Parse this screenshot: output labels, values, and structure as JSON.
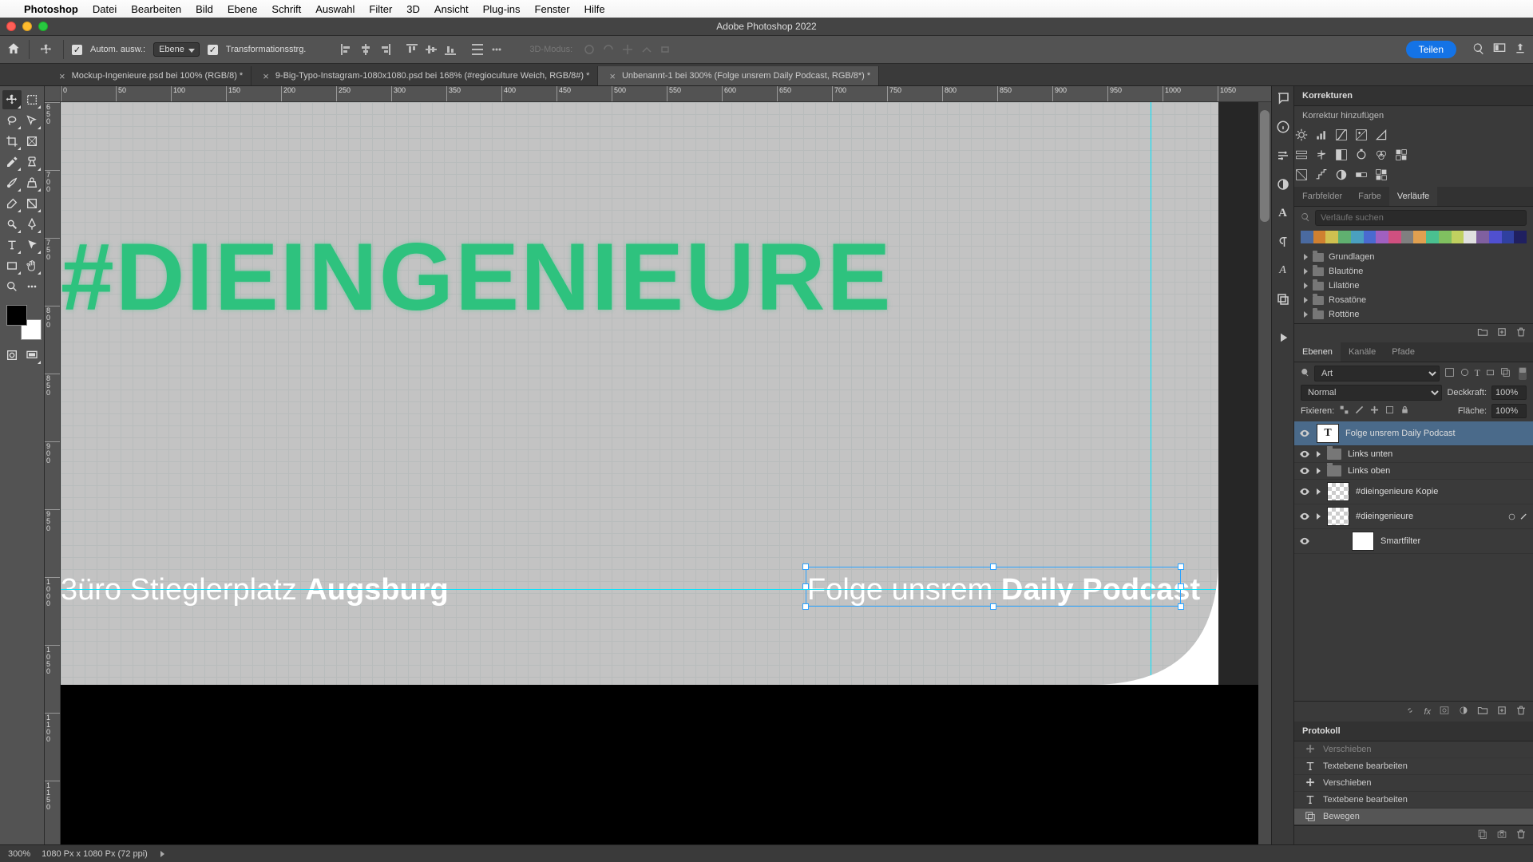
{
  "menubar": {
    "app": "Photoshop",
    "items": [
      "Datei",
      "Bearbeiten",
      "Bild",
      "Ebene",
      "Schrift",
      "Auswahl",
      "Filter",
      "3D",
      "Ansicht",
      "Plug-ins",
      "Fenster",
      "Hilfe"
    ]
  },
  "window": {
    "title": "Adobe Photoshop 2022"
  },
  "options": {
    "auto_select_label": "Autom. ausw.:",
    "auto_select_value": "Ebene",
    "transform_label": "Transformationsstrg.",
    "mode3d_label": "3D-Modus:",
    "share_label": "Teilen"
  },
  "tabs": [
    {
      "label": "Mockup-Ingenieure.psd bei 100% (RGB/8) *",
      "active": false
    },
    {
      "label": "9-Big-Typo-Instagram-1080x1080.psd bei 168% (#regioculture Weich, RGB/8#) *",
      "active": false
    },
    {
      "label": "Unbenannt-1 bei 300% (Folge unsrem Daily Podcast, RGB/8*) *",
      "active": true
    }
  ],
  "ruler_h": [
    "0",
    "50",
    "100",
    "150",
    "200",
    "250",
    "300",
    "350",
    "400",
    "450",
    "500",
    "550",
    "600",
    "650",
    "700",
    "750",
    "800",
    "850",
    "900",
    "950",
    "1000",
    "1050"
  ],
  "ruler_v": [
    "650",
    "700",
    "750",
    "800",
    "850",
    "900",
    "950",
    "1000",
    "1050",
    "1100",
    "1150"
  ],
  "canvas": {
    "big_text": "#DIEINGENIEURE",
    "left_text_prefix": "3üro Stieglerplatz ",
    "left_text_bold": "Augsburg",
    "right_text_prefix": "Folge unsrem ",
    "right_text_bold": "Daily Podcast"
  },
  "panels": {
    "corrections": {
      "title": "Korrekturen",
      "hint": "Korrektur hinzufügen"
    },
    "swatch_tabs": [
      "Farbfelder",
      "Farbe",
      "Verläufe"
    ],
    "search_placeholder": "Verläufe suchen",
    "gradient_colors": [
      "#4a6aa0",
      "#d08030",
      "#d0c050",
      "#60b070",
      "#4aa0c0",
      "#4a6ad0",
      "#a060c0",
      "#d05080",
      "#808080",
      "#e0a050",
      "#4ac090",
      "#80c060",
      "#c0d060",
      "#e0e0e0",
      "#8060a0",
      "#5050d0",
      "#3040a0",
      "#202060"
    ],
    "folders": [
      "Grundlagen",
      "Blautöne",
      "Lilatöne",
      "Rosatöne",
      "Rottöne"
    ]
  },
  "layers_panel": {
    "tabs": [
      "Ebenen",
      "Kanäle",
      "Pfade"
    ],
    "kind_label": "Art",
    "blend_mode": "Normal",
    "opacity_label": "Deckkraft:",
    "opacity_value": "100%",
    "lock_label": "Fixieren:",
    "fill_label": "Fläche:",
    "fill_value": "100%",
    "layers": [
      {
        "name": "Folge unsrem Daily Podcast",
        "type": "text",
        "selected": true,
        "eye": true
      },
      {
        "name": "Links unten",
        "type": "folder",
        "eye": true
      },
      {
        "name": "Links oben",
        "type": "folder",
        "eye": true
      },
      {
        "name": "#dieingenieure Kopie",
        "type": "smart",
        "eye": true
      },
      {
        "name": "#dieingenieure",
        "type": "smart",
        "eye": true,
        "expanded": true,
        "badges": true
      },
      {
        "name": "Smartfilter",
        "type": "filter",
        "eye": true,
        "indent": 2
      }
    ]
  },
  "history": {
    "title": "Protokoll",
    "items": [
      {
        "name": "Verschieben",
        "icon": "move",
        "dim": true
      },
      {
        "name": "Textebene bearbeiten",
        "icon": "text"
      },
      {
        "name": "Verschieben",
        "icon": "move"
      },
      {
        "name": "Textebene bearbeiten",
        "icon": "text"
      },
      {
        "name": "Bewegen",
        "icon": "layer",
        "selected": true
      }
    ]
  },
  "status": {
    "zoom": "300%",
    "info": "1080 Px x 1080 Px (72 ppi)"
  }
}
